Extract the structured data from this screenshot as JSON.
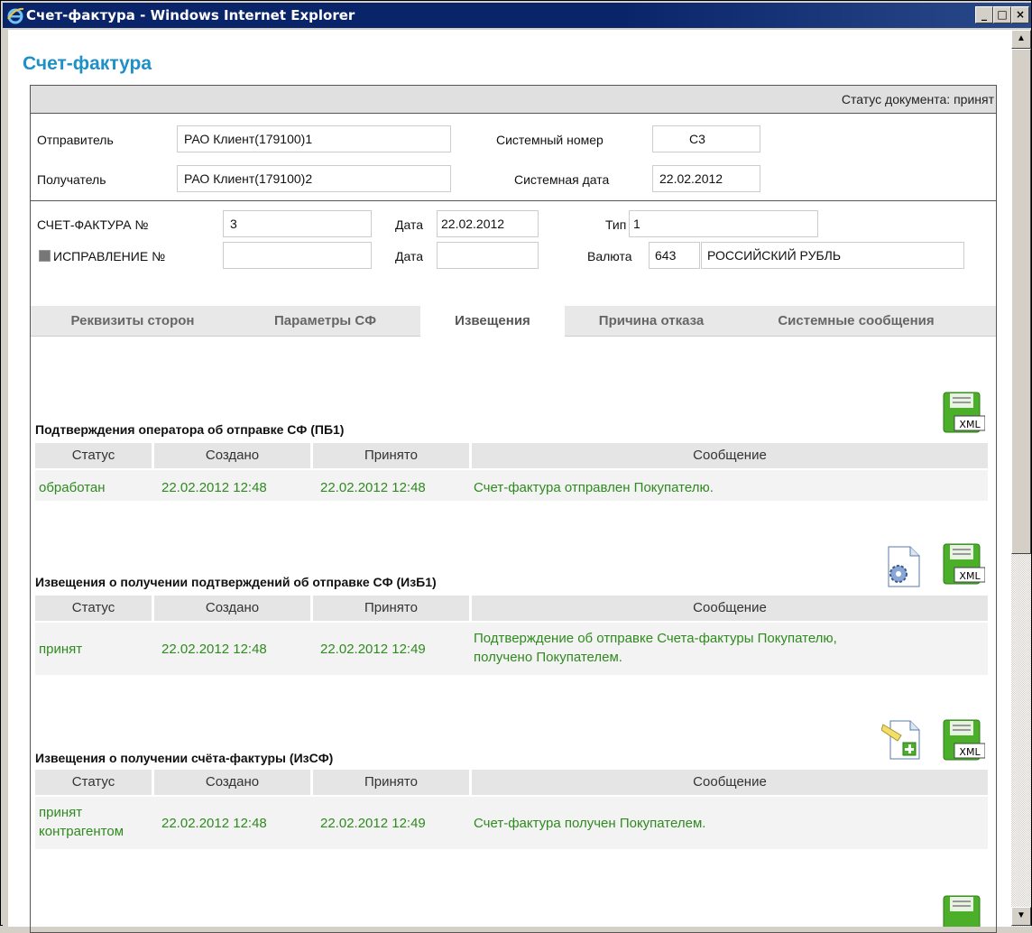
{
  "window": {
    "title": "Счет-фактура - Windows Internet Explorer"
  },
  "page": {
    "title": "Счет-фактура",
    "status": "Статус документа: принят"
  },
  "parties": {
    "sender_label": "Отправитель",
    "sender_value": "РАО Клиент(179100)1",
    "recipient_label": "Получатель",
    "recipient_value": "РАО Клиент(179100)2",
    "sysnum_label": "Системный номер",
    "sysnum_value": "С3",
    "sysdate_label": "Системная дата",
    "sysdate_value": "22.02.2012"
  },
  "invoice": {
    "number_label": "СЧЕТ-ФАКТУРА №",
    "number_value": "3",
    "date_label": "Дата",
    "date_value": "22.02.2012",
    "type_label": "Тип",
    "type_value": "1",
    "correction_label": "ИСПРАВЛЕНИЕ №",
    "correction_value": "",
    "correction_date_label": "Дата",
    "correction_date_value": "",
    "currency_label": "Валюта",
    "currency_code": "643",
    "currency_name": "РОССИЙСКИЙ РУБЛЬ"
  },
  "tabs": [
    {
      "label": "Реквизиты сторон"
    },
    {
      "label": "Параметры СФ"
    },
    {
      "label": "Извещения"
    },
    {
      "label": "Причина отказа"
    },
    {
      "label": "Системные сообщения"
    }
  ],
  "columns": {
    "status": "Статус",
    "created": "Создано",
    "accepted": "Принято",
    "message": "Сообщение"
  },
  "sections": [
    {
      "title": "Подтверждения оператора об отправке СФ (ПБ1)",
      "row": {
        "status": "обработан",
        "created": "22.02.2012 12:48",
        "accepted": "22.02.2012 12:48",
        "message": "Счет-фактура отправлен Покупателю."
      }
    },
    {
      "title": "Извещения о получении подтверждений об отправке СФ (ИзБ1)",
      "row": {
        "status": "принят",
        "created": "22.02.2012 12:48",
        "accepted": "22.02.2012 12:49",
        "message_line1": "Подтверждение об отправке Счета-фактуры Покупателю,",
        "message_line2": "получено Покупателем."
      }
    },
    {
      "title": "Извещения о получении счёта-фактуры (ИзСФ)",
      "row": {
        "status_line1": "принят",
        "status_line2": "контрагентом",
        "created": "22.02.2012 12:48",
        "accepted": "22.02.2012 12:49",
        "message": "Счет-фактура получен Покупателем."
      }
    }
  ],
  "icons": {
    "xml": "xml-save-icon",
    "gear_doc": "gear-document-icon",
    "add_doc": "add-document-icon",
    "xml_label": "XML"
  },
  "colors": {
    "accent": "#1e90c8",
    "success_text": "#2f8a1f"
  }
}
